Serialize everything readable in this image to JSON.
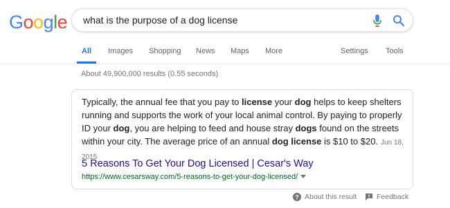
{
  "logo": {
    "letters": [
      "G",
      "o",
      "o",
      "g",
      "l",
      "e"
    ],
    "colors": [
      "#4285f4",
      "#ea4335",
      "#fbbc05",
      "#4285f4",
      "#34a853",
      "#ea4335"
    ]
  },
  "search": {
    "query": "what is the purpose of a dog license",
    "icons": [
      "mic-icon",
      "search-icon"
    ]
  },
  "tabs": {
    "all": "All",
    "images": "Images",
    "shopping": "Shopping",
    "news": "News",
    "maps": "Maps",
    "more": "More",
    "settings": "Settings",
    "tools": "Tools"
  },
  "results": {
    "stats": "About 49,900,000 results (0.55 seconds)"
  },
  "featured_snippet": {
    "text_parts": [
      {
        "text": "Typically, the annual fee that you pay to ",
        "bold": false
      },
      {
        "text": "license",
        "bold": true
      },
      {
        "text": " your ",
        "bold": false
      },
      {
        "text": "dog",
        "bold": true
      },
      {
        "text": " helps to keep shelters running and supports the work of your local animal control. By paying to properly ID your ",
        "bold": false
      },
      {
        "text": "dog",
        "bold": true
      },
      {
        "text": ", you are helping to feed and house stray ",
        "bold": false
      },
      {
        "text": "dogs",
        "bold": true
      },
      {
        "text": " found on the streets within your city. The average price of an annual ",
        "bold": false
      },
      {
        "text": "dog license",
        "bold": true
      },
      {
        "text": " is $10 to $20.",
        "bold": false
      }
    ],
    "date": "Jun 18, 2015",
    "title": "5 Reasons To Get Your Dog Licensed | Cesar's Way",
    "url": "https://www.cesarsway.com/5-reasons-to-get-your-dog-licensed/"
  },
  "footer": {
    "about": "About this result",
    "feedback": "Feedback"
  },
  "colors": {
    "accent": "#1a73e8",
    "link": "#1a0dab",
    "url": "#006621"
  }
}
